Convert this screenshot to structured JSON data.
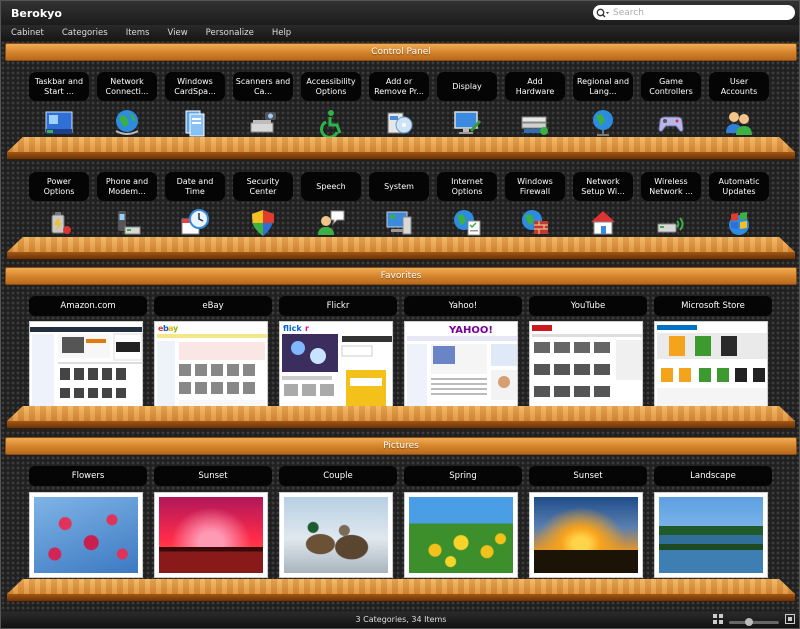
{
  "app": {
    "title": "Berokyo"
  },
  "search": {
    "placeholder": "Search"
  },
  "menu": [
    "Cabinet",
    "Categories",
    "Items",
    "View",
    "Personalize",
    "Help"
  ],
  "sections": {
    "control_panel": "Control Panel",
    "favorites": "Favorites",
    "pictures": "Pictures"
  },
  "control_panel": {
    "row1": [
      {
        "label": "Taskbar and Start ...",
        "icon": "taskbar-icon"
      },
      {
        "label": "Network Connecti...",
        "icon": "network-globe-icon"
      },
      {
        "label": "Windows CardSpa...",
        "icon": "cardspace-icon"
      },
      {
        "label": "Scanners and Ca...",
        "icon": "scanner-icon"
      },
      {
        "label": "Accessibility Options",
        "icon": "accessibility-icon"
      },
      {
        "label": "Add or Remove Pr...",
        "icon": "add-remove-icon"
      },
      {
        "label": "Display",
        "icon": "display-icon"
      },
      {
        "label": "Add Hardware",
        "icon": "hardware-icon"
      },
      {
        "label": "Regional and Lang...",
        "icon": "regional-globe-icon"
      },
      {
        "label": "Game Controllers",
        "icon": "gamepad-icon"
      },
      {
        "label": "User Accounts",
        "icon": "users-icon"
      }
    ],
    "row2": [
      {
        "label": "Power Options",
        "icon": "power-icon"
      },
      {
        "label": "Phone and Modem...",
        "icon": "phone-icon"
      },
      {
        "label": "Date and Time",
        "icon": "clock-icon"
      },
      {
        "label": "Security Center",
        "icon": "shield-icon"
      },
      {
        "label": "Speech",
        "icon": "speech-icon"
      },
      {
        "label": "System",
        "icon": "system-icon"
      },
      {
        "label": "Internet Options",
        "icon": "internet-icon"
      },
      {
        "label": "Windows Firewall",
        "icon": "firewall-icon"
      },
      {
        "label": "Network Setup Wi...",
        "icon": "house-icon"
      },
      {
        "label": "Wireless Network ...",
        "icon": "wireless-icon"
      },
      {
        "label": "Automatic Updates",
        "icon": "updates-icon"
      }
    ]
  },
  "favorites": [
    "Amazon.com",
    "eBay",
    "Flickr",
    "Yahoo!",
    "YouTube",
    "Microsoft Store"
  ],
  "pictures": [
    "Flowers",
    "Sunset",
    "Couple",
    "Spring",
    "Sunset",
    "Landscape"
  ],
  "status": {
    "text": "3 Categories, 34 Items",
    "zoom": 0.4
  },
  "colors": {
    "wood": "#d98c36",
    "header": "#e1963f"
  }
}
